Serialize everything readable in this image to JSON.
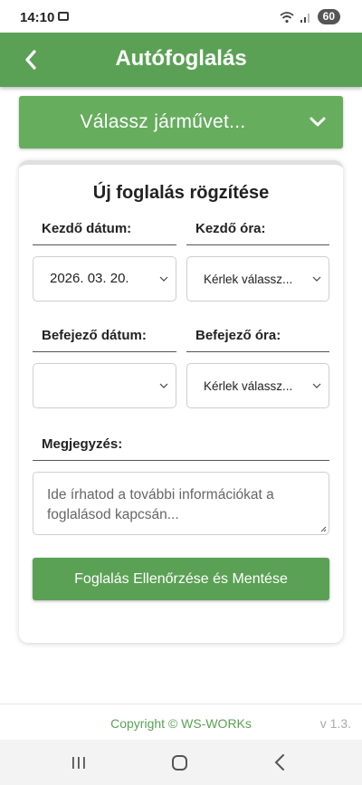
{
  "status_bar": {
    "time": "14:10",
    "battery": "60"
  },
  "app_bar": {
    "title": "Autófoglalás"
  },
  "vehicle_select": {
    "label": "Válassz járművet..."
  },
  "form": {
    "title": "Új foglalás rögzítése",
    "start_date_label": "Kezdő dátum:",
    "start_date_value": "2026. 03. 20.",
    "start_time_label": "Kezdő óra:",
    "start_time_value": "Kérlek válassz...",
    "end_date_label": "Befejező dátum:",
    "end_date_value": "",
    "end_time_label": "Befejező óra:",
    "end_time_value": "Kérlek válassz...",
    "notes_label": "Megjegyzés:",
    "notes_placeholder": "Ide írhatod a további információkat a foglalásod kapcsán...",
    "submit_label": "Foglalás Ellenőrzése és Mentése"
  },
  "footer": {
    "copyright": "Copyright © WS-WORKs",
    "version": "v 1.3."
  },
  "colors": {
    "primary": "#5ba155",
    "select_bar": "#66ad5e"
  }
}
